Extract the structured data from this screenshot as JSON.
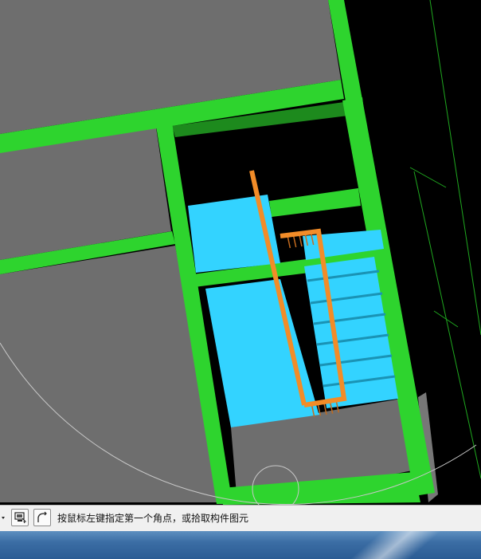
{
  "viewport": {
    "background": "#000000",
    "colors": {
      "wall": "#2ed42e",
      "wall_shadow": "#1d8a1d",
      "floor": "#6e6e6e",
      "stair": "#33d3ff",
      "stair_tread_line": "#1a93b5",
      "handrail": "#f28c28",
      "baluster": "#c46b1e",
      "guide_line": "#1fa81f",
      "arc": "#c8c8c8"
    },
    "icons": [
      "snap-circle-icon"
    ]
  },
  "command_bar": {
    "buttons": [
      {
        "name": "dropdown-arrow-icon"
      },
      {
        "name": "monitor-pick-icon"
      },
      {
        "name": "curve-draw-icon"
      }
    ],
    "prompt": "按鼠标左键指定第一个角点，或拾取构件图元"
  },
  "taskbar": {
    "accent": "#3b6da4"
  }
}
